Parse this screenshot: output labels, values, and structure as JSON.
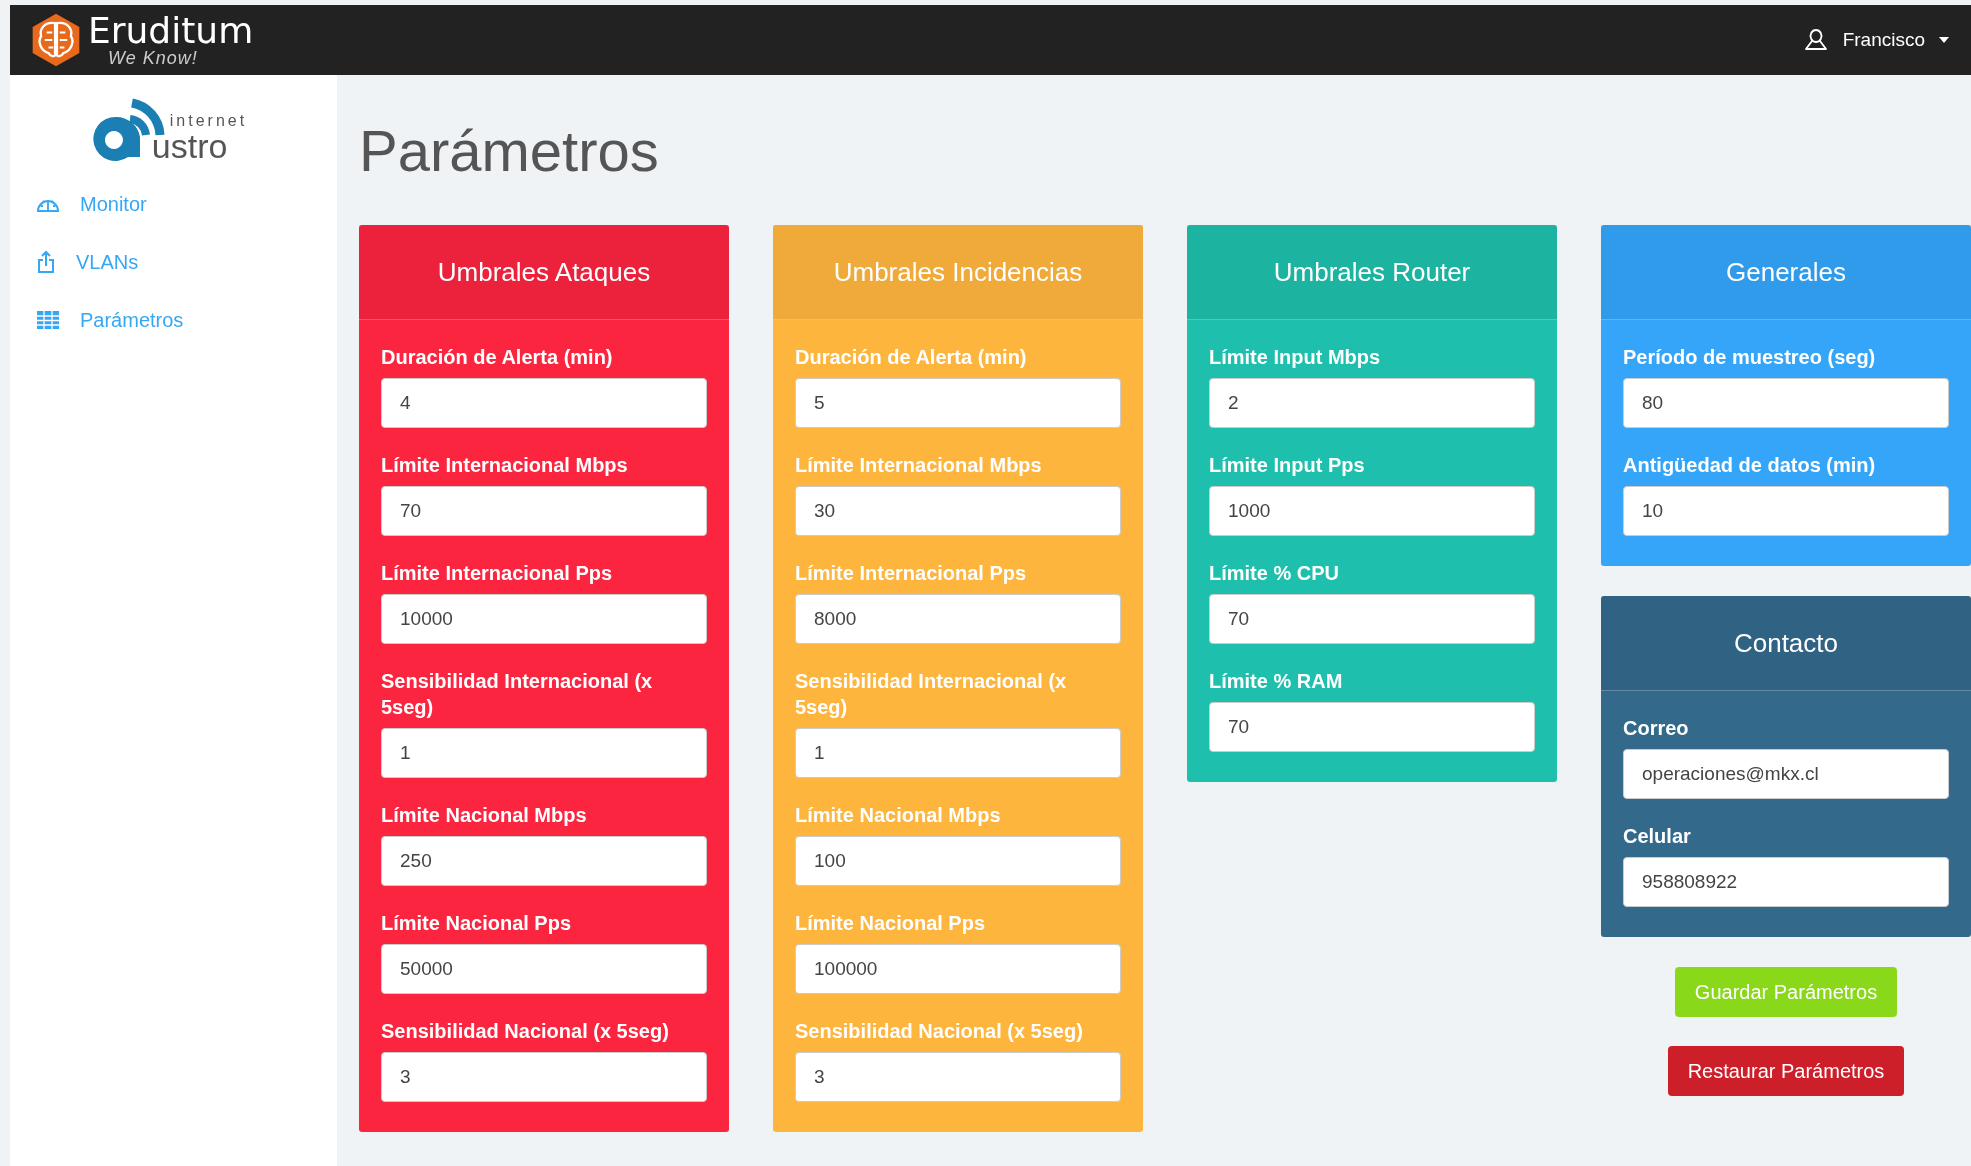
{
  "brand": {
    "name": "Eruditum",
    "tagline": "We Know!"
  },
  "user": {
    "name": "Francisco"
  },
  "sidebar": {
    "logo": {
      "top": "internet",
      "bottom": "ustro"
    },
    "items": [
      {
        "label": "Monitor",
        "kind": "gauge"
      },
      {
        "label": "VLANs",
        "kind": "share"
      },
      {
        "label": "Parámetros",
        "kind": "table"
      }
    ]
  },
  "page_title": "Parámetros",
  "columns": [
    {
      "panels": [
        {
          "title": "Umbrales Ataques",
          "color": "#fb2540",
          "fields": [
            {
              "label": "Duración de Alerta (min)",
              "value": "4"
            },
            {
              "label": "Límite Internacional Mbps",
              "value": "70"
            },
            {
              "label": "Límite Internacional Pps",
              "value": "10000"
            },
            {
              "label": "Sensibilidad Internacional (x 5seg)",
              "value": "1"
            },
            {
              "label": "Límite Nacional Mbps",
              "value": "250"
            },
            {
              "label": "Límite Nacional Pps",
              "value": "50000"
            },
            {
              "label": "Sensibilidad Nacional (x 5seg)",
              "value": "3"
            }
          ]
        }
      ]
    },
    {
      "panels": [
        {
          "title": "Umbrales Incidencias",
          "color": "#feb53d",
          "fields": [
            {
              "label": "Duración de Alerta (min)",
              "value": "5"
            },
            {
              "label": "Límite Internacional Mbps",
              "value": "30"
            },
            {
              "label": "Límite Internacional Pps",
              "value": "8000"
            },
            {
              "label": "Sensibilidad Internacional (x 5seg)",
              "value": "1"
            },
            {
              "label": "Límite Nacional Mbps",
              "value": "100"
            },
            {
              "label": "Límite Nacional Pps",
              "value": "100000"
            },
            {
              "label": "Sensibilidad Nacional (x 5seg)",
              "value": "3"
            }
          ]
        }
      ]
    },
    {
      "panels": [
        {
          "title": "Umbrales Router",
          "color": "#1ebfac",
          "fields": [
            {
              "label": "Límite Input Mbps",
              "value": "2"
            },
            {
              "label": "Límite Input Pps",
              "value": "1000"
            },
            {
              "label": "Límite % CPU",
              "value": "70"
            },
            {
              "label": "Límite % RAM",
              "value": "70"
            }
          ]
        }
      ]
    },
    {
      "panels": [
        {
          "title": "Generales",
          "color": "#35a5fa",
          "fields": [
            {
              "label": "Período de muestreo (seg)",
              "value": "80"
            },
            {
              "label": "Antigüedad de datos (min)",
              "value": "10"
            }
          ]
        },
        {
          "title": "Contacto",
          "color": "#336a8c",
          "fields": [
            {
              "label": "Correo",
              "value": "operaciones@mkx.cl"
            },
            {
              "label": "Celular",
              "value": "958808922"
            }
          ]
        }
      ],
      "buttons": [
        {
          "label": "Guardar Parámetros",
          "kind": "save"
        },
        {
          "label": "Restaurar Parámetros",
          "kind": "reset"
        }
      ]
    }
  ]
}
